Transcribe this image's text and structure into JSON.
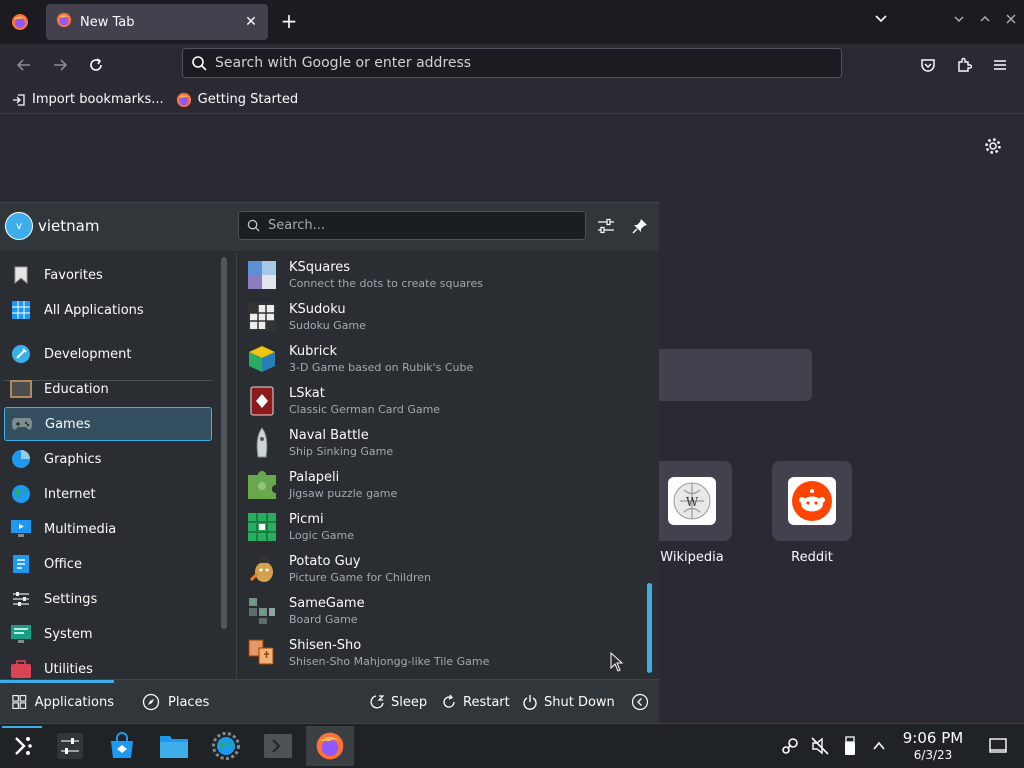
{
  "browser": {
    "tab_title": "New Tab",
    "url_placeholder": "Search with Google or enter address",
    "bookmarks": [
      {
        "label": "Import bookmarks...",
        "icon": "import-icon"
      },
      {
        "label": "Getting Started",
        "icon": "firefox-icon"
      }
    ],
    "shortcuts": [
      {
        "label": "Wikipedia",
        "icon": "wikipedia-icon"
      },
      {
        "label": "Reddit",
        "icon": "reddit-icon"
      }
    ]
  },
  "launcher": {
    "user": {
      "initial": "v",
      "name": "vietnam"
    },
    "search_placeholder": "Search...",
    "categories": [
      {
        "label": "Favorites",
        "icon": "bookmark-icon"
      },
      {
        "label": "All Applications",
        "icon": "grid-icon"
      },
      {
        "label": "Development",
        "icon": "wrench-icon"
      },
      {
        "label": "Education",
        "icon": "blackboard-icon"
      },
      {
        "label": "Games",
        "icon": "gamepad-icon",
        "active": true
      },
      {
        "label": "Graphics",
        "icon": "graphics-icon"
      },
      {
        "label": "Internet",
        "icon": "globe-icon"
      },
      {
        "label": "Multimedia",
        "icon": "monitor-icon"
      },
      {
        "label": "Office",
        "icon": "document-icon"
      },
      {
        "label": "Settings",
        "icon": "sliders-icon"
      },
      {
        "label": "System",
        "icon": "system-icon"
      },
      {
        "label": "Utilities",
        "icon": "toolbox-icon"
      }
    ],
    "apps": [
      {
        "name": "KSquares",
        "desc": "Connect the dots to create squares"
      },
      {
        "name": "KSudoku",
        "desc": "Sudoku Game"
      },
      {
        "name": "Kubrick",
        "desc": "3-D Game based on Rubik's Cube"
      },
      {
        "name": "LSkat",
        "desc": "Classic German Card Game"
      },
      {
        "name": "Naval Battle",
        "desc": "Ship Sinking Game"
      },
      {
        "name": "Palapeli",
        "desc": "Jigsaw puzzle game"
      },
      {
        "name": "Picmi",
        "desc": "Logic Game"
      },
      {
        "name": "Potato Guy",
        "desc": "Picture Game for Children"
      },
      {
        "name": "SameGame",
        "desc": "Board Game"
      },
      {
        "name": "Shisen-Sho",
        "desc": "Shisen-Sho Mahjongg-like Tile Game"
      }
    ],
    "footer": {
      "applications": "Applications",
      "places": "Places",
      "sleep": "Sleep",
      "restart": "Restart",
      "shutdown": "Shut Down"
    }
  },
  "taskbar": {
    "time": "9:06 PM",
    "date": "6/3/23"
  },
  "colors": {
    "accent": "#3daee9",
    "panel": "#2a2e32",
    "firefox_bg": "#2b2a33"
  }
}
